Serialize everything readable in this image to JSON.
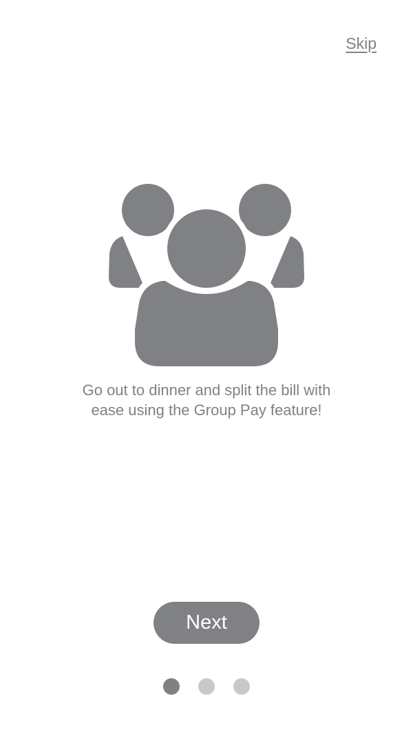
{
  "header": {
    "skip_label": "Skip"
  },
  "illustration": {
    "icon": "group-users-icon",
    "color": "#808184"
  },
  "content": {
    "caption_line1": "Go out to dinner and split the bill with",
    "caption_line2": "ease using the Group Pay feature!"
  },
  "footer": {
    "next_label": "Next",
    "page_count": 3,
    "active_page": 1
  },
  "colors": {
    "primary_gray": "#808184",
    "inactive_dot": "#c8c8cb",
    "background": "#ffffff",
    "button_text": "#ffffff"
  }
}
